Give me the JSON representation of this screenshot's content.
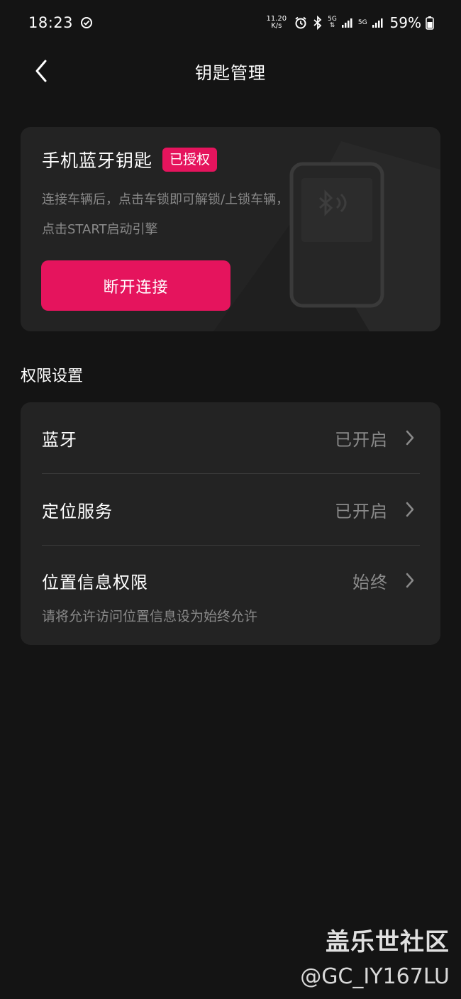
{
  "status_bar": {
    "time": "18:23",
    "net_speed_value": "11.20",
    "net_speed_unit": "K/s",
    "net_type_1": "5G",
    "net_type_2": "5G",
    "battery": "59%"
  },
  "header": {
    "title": "钥匙管理"
  },
  "key_card": {
    "title": "手机蓝牙钥匙",
    "badge": "已授权",
    "description": "连接车辆后，点击车锁即可解锁/上锁车辆，点击START启动引擎",
    "button_label": "断开连接"
  },
  "permissions": {
    "section_title": "权限设置",
    "items": [
      {
        "label": "蓝牙",
        "value": "已开启"
      },
      {
        "label": "定位服务",
        "value": "已开启"
      },
      {
        "label": "位置信息权限",
        "value": "始终"
      }
    ],
    "hint": "请将允许访问位置信息设为始终允许"
  },
  "watermark": {
    "line1": "盖乐世社区",
    "line2": "@GC_IY167LU"
  },
  "colors": {
    "accent": "#e5145d",
    "background": "#141414",
    "card": "#232323",
    "secondary_text": "#8a8a8a"
  }
}
